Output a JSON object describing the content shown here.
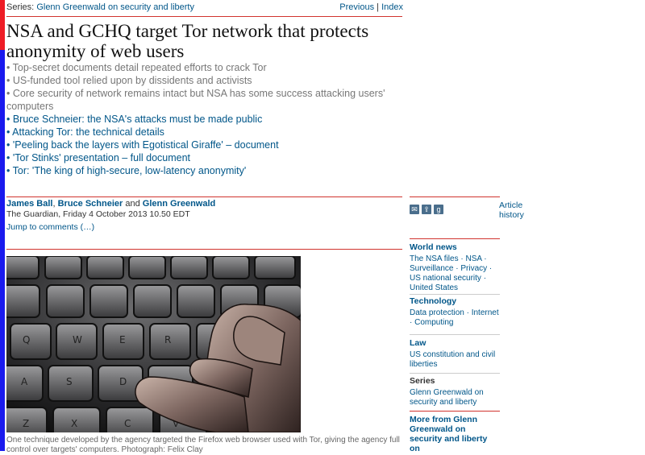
{
  "topbar": {
    "series_label": "Series:",
    "series_name": "Glenn Greenwald on security and liberty",
    "previous": "Previous",
    "sep": " | ",
    "index": "Index"
  },
  "headline": "NSA and GCHQ target Tor network that protects anonymity of web users",
  "standfirst": [
    {
      "text": "• Top-secret documents detail repeated efforts to crack Tor",
      "link": false
    },
    {
      "text": "• US-funded tool relied upon by dissidents and activists",
      "link": false
    },
    {
      "text": "• Core security of network remains intact but NSA has some success attacking users' computers",
      "link": false
    },
    {
      "text": "• Bruce Schneier: the NSA's attacks must be made public",
      "link": true
    },
    {
      "text": "• Attacking Tor: the technical details",
      "link": true
    },
    {
      "text": "• 'Peeling back the layers with Egotistical Giraffe' – document",
      "link": true
    },
    {
      "text": "• 'Tor Stinks' presentation – full document",
      "link": true
    },
    {
      "text": "• Tor: 'The king of high-secure, low-latency anonymity'",
      "link": true
    }
  ],
  "byline": {
    "author1": "James Ball",
    "comma": ", ",
    "author2": "Bruce Schneier",
    "and": " and ",
    "author3": "Glenn Greenwald"
  },
  "dateline": "The Guardian, Friday 4 October 2013 10.50 EDT",
  "jump_to_comments": "Jump to comments (…)",
  "caption": "One technique developed by the agency targeted the Firefox web browser used with Tor, giving the agency full control over targets' computers. Photograph: Felix Clay",
  "article_history": "Article history",
  "sidebar": [
    {
      "head": "World news",
      "body": "The NSA files · NSA · Surveillance · Privacy · US national security · United States"
    },
    {
      "head": "Technology",
      "body": "Data protection · Internet · Computing"
    },
    {
      "head": "Law",
      "body": "US constitution and civil liberties"
    },
    {
      "head": "Series",
      "body": "Glenn Greenwald on security and liberty"
    },
    {
      "head": "More from Glenn Greenwald on security and liberty on",
      "body": ""
    }
  ],
  "colors": {
    "accent_red": "#d1342f",
    "link_blue": "#005689"
  },
  "icons": [
    "email-icon",
    "share-icon",
    "google-plus-icon"
  ]
}
